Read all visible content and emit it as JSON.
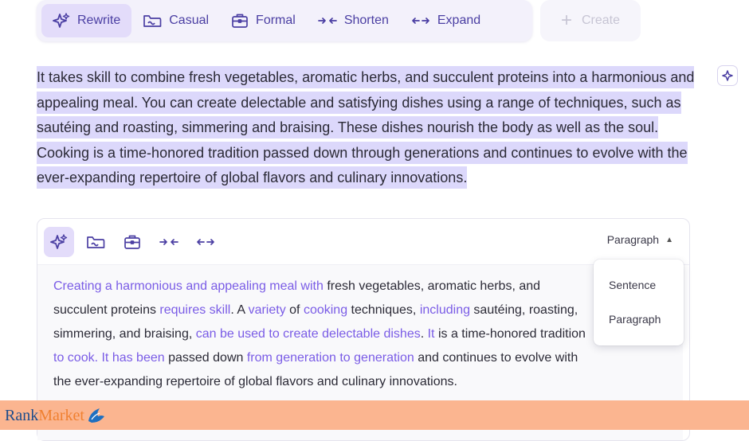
{
  "toolbar": {
    "rewrite": "Rewrite",
    "casual": "Casual",
    "formal": "Formal",
    "shorten": "Shorten",
    "expand": "Expand",
    "create": "Create"
  },
  "selected_text": "It takes skill to combine fresh vegetables, aromatic herbs, and succulent proteins into a harmonious and appealing meal. You can create delectable and satisfying dishes using a range of techniques, such as sautéing and roasting, simmering and braising. These dishes nourish the body as well as the soul. Cooking is a time-honored tradition passed down through generations and continues to evolve with the ever-expanding repertoire of global flavors and culinary innovations.",
  "card": {
    "mode_label": "Paragraph",
    "suggestion": [
      {
        "t": "Creating a harmonious and appealing meal with",
        "add": true
      },
      {
        "t": " fresh vegetables, aromatic herbs, and succulent proteins ",
        "add": false
      },
      {
        "t": "requires skill",
        "add": true
      },
      {
        "t": ". A ",
        "add": false
      },
      {
        "t": "variety",
        "add": true
      },
      {
        "t": " of ",
        "add": false
      },
      {
        "t": "cooking",
        "add": true
      },
      {
        "t": " techniques, ",
        "add": false
      },
      {
        "t": "including",
        "add": true
      },
      {
        "t": " sautéing, roasting, simmering, and braising, ",
        "add": false
      },
      {
        "t": "can be used to create delectable dishes",
        "add": true
      },
      {
        "t": ". ",
        "add": false
      },
      {
        "t": "It",
        "add": true
      },
      {
        "t": " is a time-honored tradition ",
        "add": false
      },
      {
        "t": "to cook. It has been",
        "add": true
      },
      {
        "t": " passed down ",
        "add": false
      },
      {
        "t": "from generation to generation",
        "add": true
      },
      {
        "t": " and continues to evolve with the ever-expanding repertoire of global flavors and culinary innovations.",
        "add": false
      }
    ]
  },
  "dropdown": {
    "options": [
      "Sentence",
      "Paragraph"
    ]
  },
  "watermark": {
    "rank": "Rank",
    "market": "Market"
  },
  "colors": {
    "accent": "#4b3fa3",
    "added_text": "#7a5ce6",
    "highlight": "#dcd8fb",
    "banner": "#fbb590"
  }
}
